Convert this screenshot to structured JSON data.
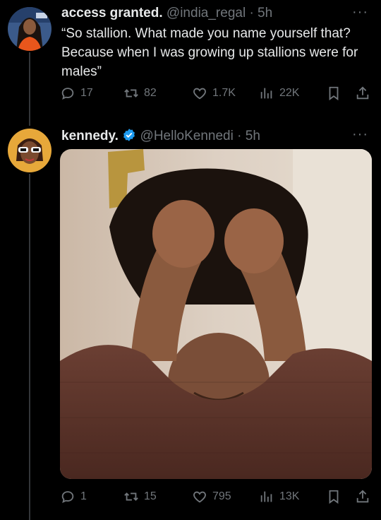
{
  "colors": {
    "background": "#000000",
    "text": "#e7e9ea",
    "muted": "#71767b",
    "verified": "#1d9bf0"
  },
  "reply_tweet": {
    "display_name": "access granted.",
    "handle": "@india_regal",
    "time": "· 5h",
    "more": "···",
    "text": "“So stallion. What made you name yourself that? Because when I was growing up stallions were for males”",
    "stats": {
      "replies": "17",
      "reposts": "82",
      "likes": "1.7K",
      "views": "22K"
    }
  },
  "main_tweet": {
    "display_name": "kennedy.",
    "verified": true,
    "handle": "@HelloKennedi",
    "time": "· 5h",
    "more": "···",
    "media_description_icon": "video-thumbnail",
    "stats": {
      "replies": "1",
      "reposts": "15",
      "likes": "795",
      "views": "13K"
    }
  },
  "icons": [
    "reply-icon",
    "repost-icon",
    "like-icon",
    "views-icon",
    "bookmark-icon",
    "share-icon",
    "verified-badge-icon"
  ]
}
